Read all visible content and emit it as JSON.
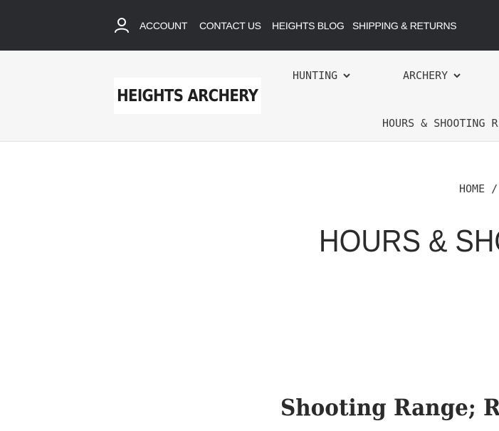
{
  "topbar": {
    "account_label": "ACCOUNT",
    "contact_label": "CONTACT US",
    "blog_label": "HEIGHTS BLOG",
    "shipping_label": "SHIPPING & RETURNS",
    "background": "#2a2b2f"
  },
  "header": {
    "logo_text": "HEIGHTS ARCHERY",
    "nav": {
      "hunting": "HUNTING",
      "archery": "ARCHERY",
      "hours": "HOURS & SHOOTING R"
    },
    "background": "#f6f6f6"
  },
  "breadcrumb": {
    "home": "HOME",
    "separator": "/"
  },
  "page": {
    "title": "HOURS & SHO",
    "section_heading": "Shooting Range; R"
  },
  "icons": {
    "account": "user-icon",
    "dropdown": "chevron-down-icon"
  }
}
